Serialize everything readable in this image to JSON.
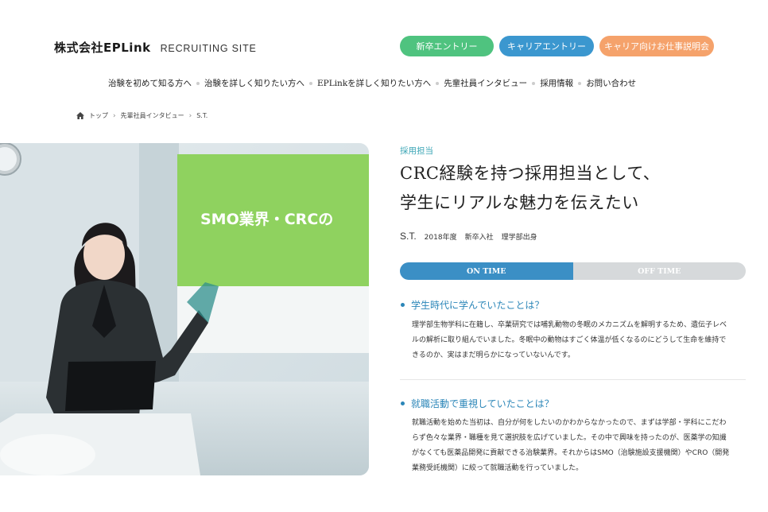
{
  "header": {
    "brand": "株式会社EPLink",
    "site_label": "RECRUITING SITE",
    "buttons": {
      "new_grad": "新卒エントリー",
      "career": "キャリアエントリー",
      "briefing": "キャリア向けお仕事説明会"
    },
    "colors": {
      "new_grad": "#4fc37f",
      "career": "#3b97cf",
      "briefing": "#f5a26b"
    }
  },
  "nav": {
    "items": [
      "治験を初めて知る方へ",
      "治験を詳しく知りたい方へ",
      "EPLinkを詳しく知りたい方へ",
      "先輩社員インタビュー",
      "採用情報",
      "お問い合わせ"
    ]
  },
  "breadcrumb": {
    "home": "トップ",
    "section": "先輩社員インタビュー",
    "current": "S.T."
  },
  "photo": {
    "slide_text": "SMO業界・CRCの"
  },
  "article": {
    "category": "採用担当",
    "headline_line1": "CRC経験を持つ採用担当として、",
    "headline_line2": "学生にリアルな魅力を伝えたい",
    "person_name": "S.T.",
    "person_year": "2018年度",
    "person_entry": "新卒入社",
    "person_major": "理学部出身",
    "tabs": {
      "on": "ON TIME",
      "off": "OFF TIME"
    },
    "q1": "学生時代に学んでいたことは？",
    "a1_line1": "理学部生物学科に在籍し、卒業研究では哺乳動物の冬眠のメカニズムを解明するため、遺伝子レベ",
    "a1_line2": "ルの解析に取り組んでいました。冬眠中の動物はすごく体温が低くなるのにどうして生命を維持で",
    "a1_line3": "きるのか、実はまだ明らかになっていないんです。",
    "q2": "就職活動で重視していたことは？",
    "a2_line1": "就職活動を始めた当初は、自分が何をしたいのかわからなかったので、まずは学部・学科にこだわ",
    "a2_line2": "らず色々な業界・職種を見て選択肢を広げていました。その中で興味を持ったのが、医薬学の知識",
    "a2_line3": "がなくても医薬品開発に貢献できる治験業界。それからはSMO（治験施設支援機関）やCRO（開発",
    "a2_line4": "業務受託機関）に絞って就職活動を行っていました。"
  }
}
